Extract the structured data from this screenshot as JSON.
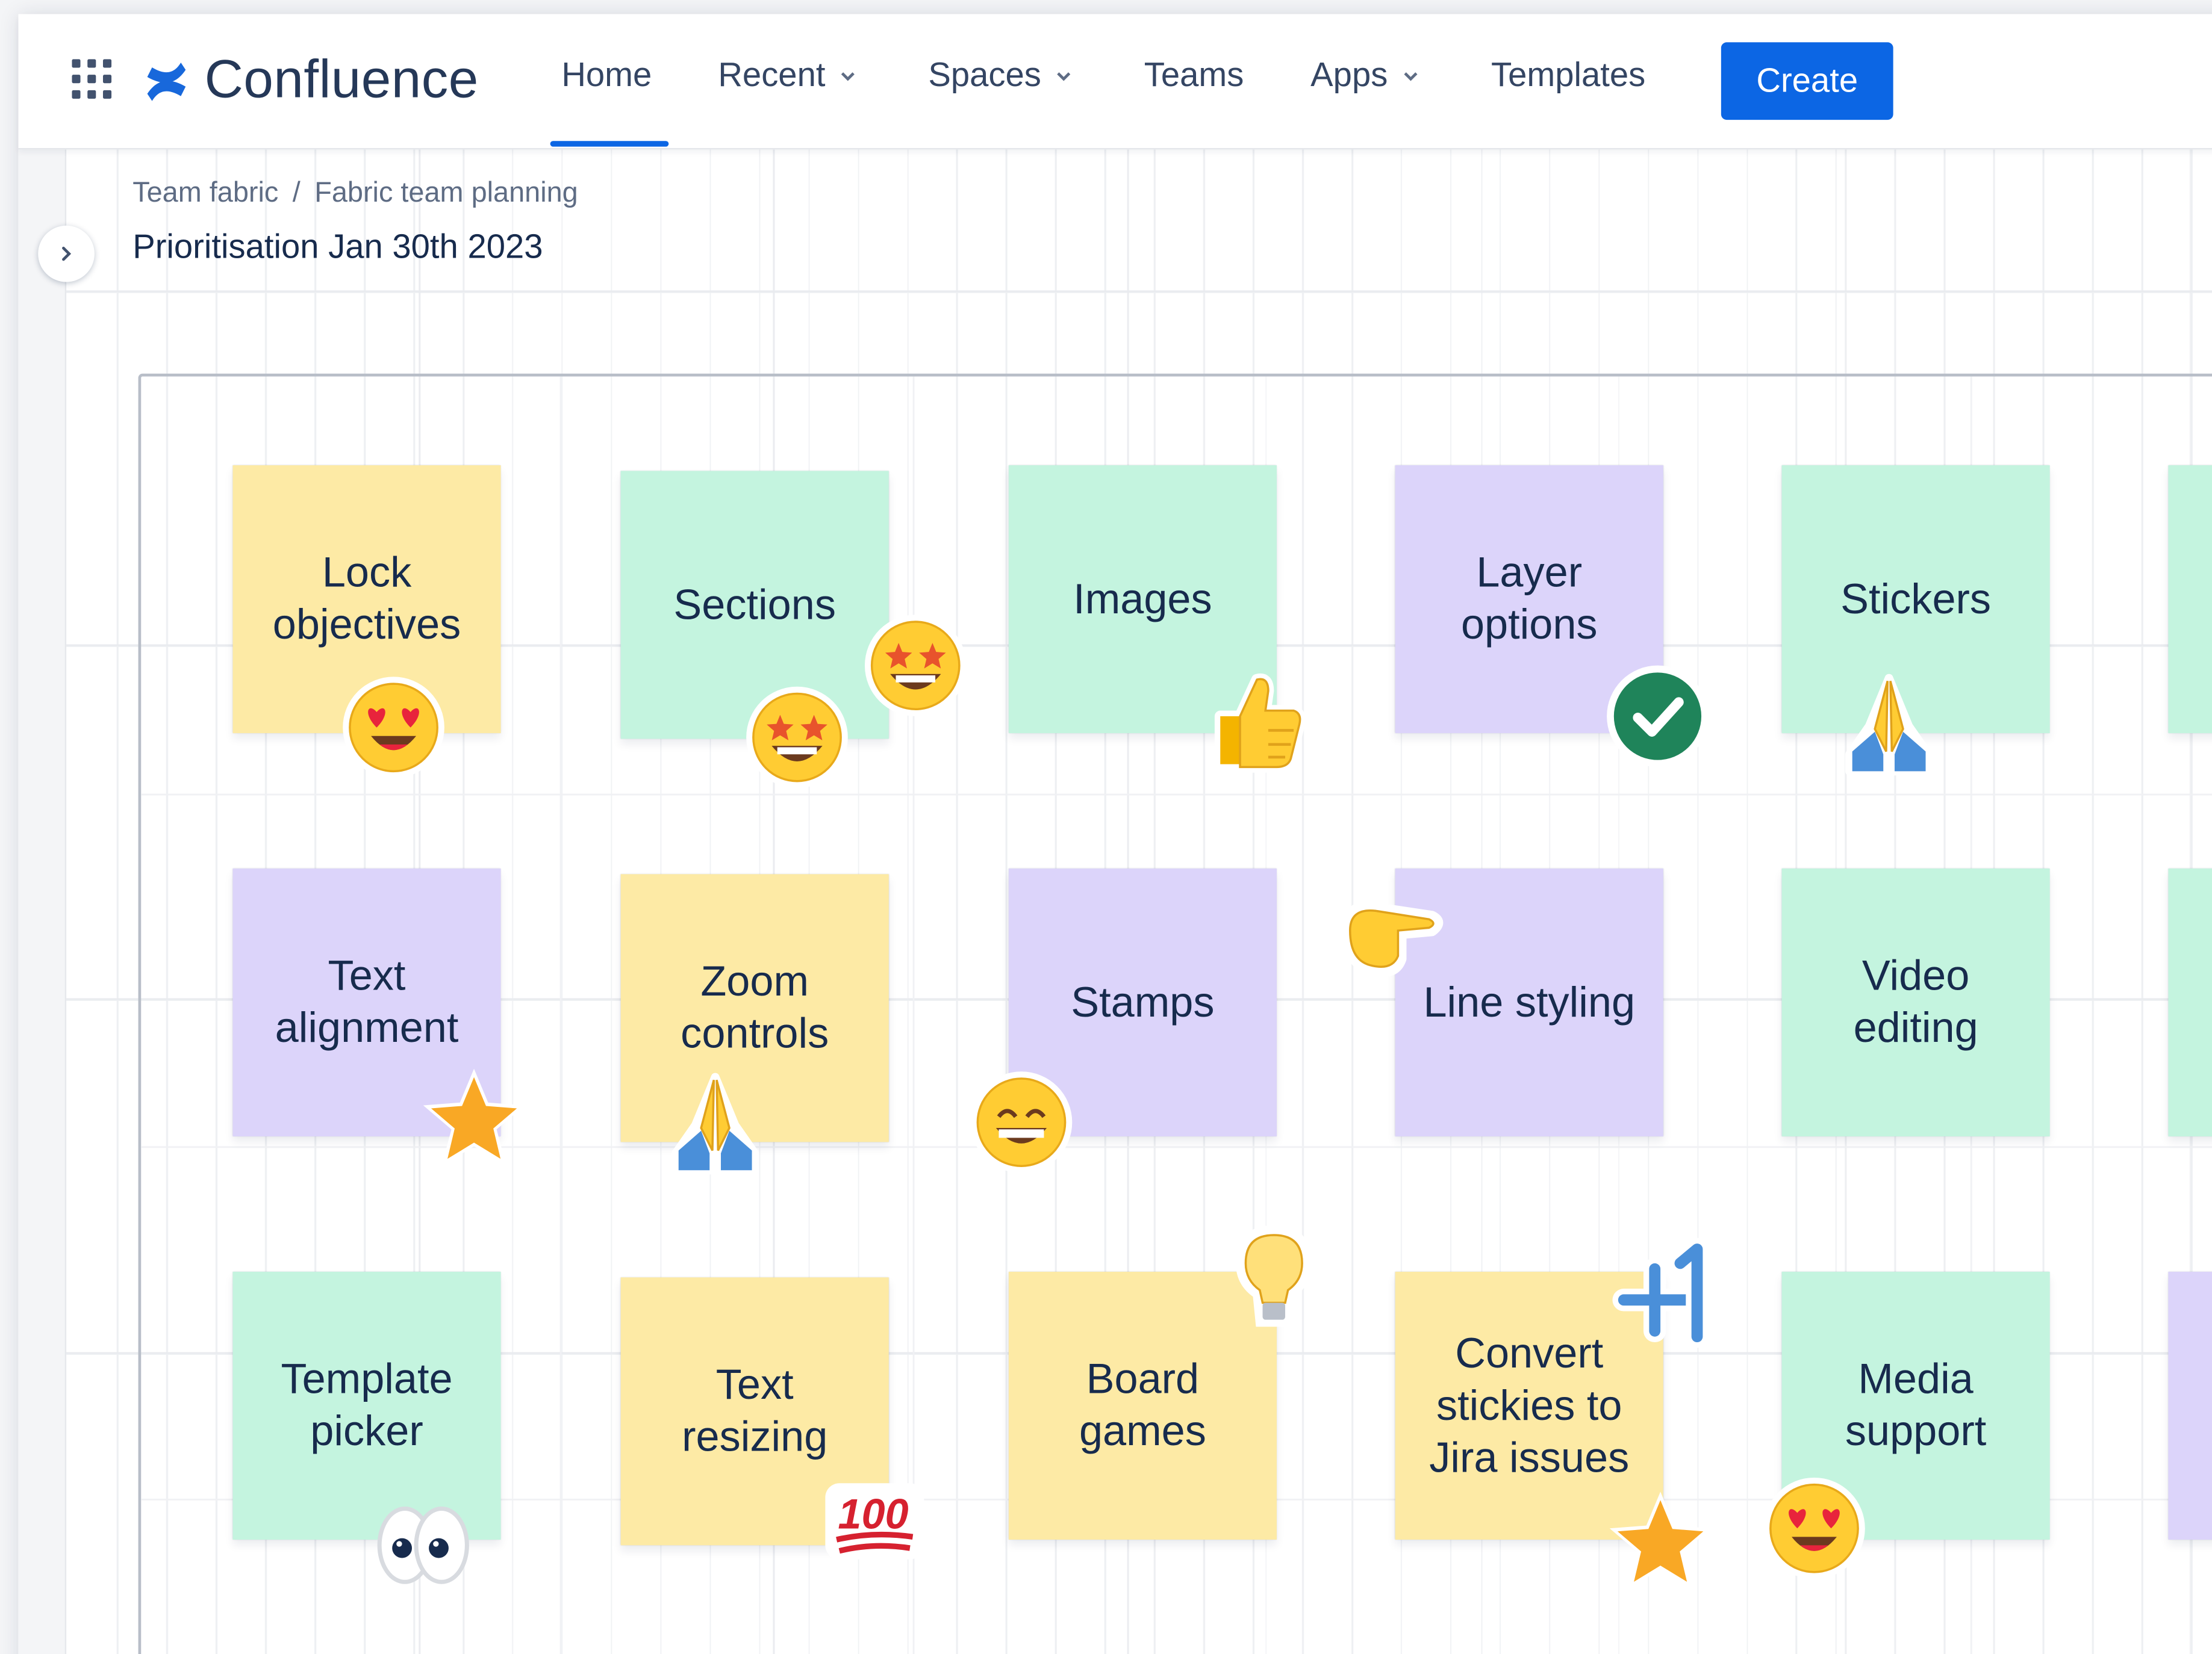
{
  "app": {
    "name": "Confluence",
    "accent": "#0c66e4"
  },
  "nav": {
    "items": [
      {
        "label": "Home",
        "dropdown": false,
        "active": true
      },
      {
        "label": "Recent",
        "dropdown": true
      },
      {
        "label": "Spaces",
        "dropdown": true
      },
      {
        "label": "Teams",
        "dropdown": false
      },
      {
        "label": "Apps",
        "dropdown": true
      },
      {
        "label": "Templates",
        "dropdown": false
      }
    ],
    "create_label": "Create"
  },
  "breadcrumb": {
    "items": [
      "Team fabric",
      "Fabric team planning"
    ],
    "separator": "/"
  },
  "page": {
    "title": "Prioritisation Jan 30th 2023"
  },
  "colors": {
    "yellow": "#fdeaa5",
    "green": "#c4f4df",
    "purple": "#dcd4fa"
  },
  "stickies": [
    {
      "label": "Lock\nobjectives",
      "color": "yellow",
      "sticker": "heart-eyes-icon"
    },
    {
      "label": "Sections",
      "color": "green",
      "sticker": "star-struck-icon"
    },
    {
      "label": "Images",
      "color": "green",
      "sticker": "thumbs-up-icon"
    },
    {
      "label": "Layer\noptions",
      "color": "purple",
      "sticker": "check-mark-icon"
    },
    {
      "label": "Stickers",
      "color": "green",
      "sticker": "folded-hands-icon"
    },
    {
      "label": "Text\nalignment",
      "color": "purple",
      "sticker": "star-icon"
    },
    {
      "label": "Zoom\ncontrols",
      "color": "yellow",
      "sticker": "folded-hands-icon"
    },
    {
      "label": "Stamps",
      "color": "purple",
      "sticker": "grinning-face-icon"
    },
    {
      "label": "Line styling",
      "color": "purple",
      "sticker": "pointing-hand-icon"
    },
    {
      "label": "Video\nediting",
      "color": "green",
      "sticker": null
    },
    {
      "label": "Template\npicker",
      "color": "green",
      "sticker": "eyes-icon"
    },
    {
      "label": "Text\nresizing",
      "color": "yellow",
      "sticker": "hundred-points-icon"
    },
    {
      "label": "Board\ngames",
      "color": "yellow",
      "sticker": "light-bulb-icon"
    },
    {
      "label": "Convert\nstickies to\nJira issues",
      "color": "yellow",
      "sticker": "plus-one-icon"
    },
    {
      "label": "Media\nsupport",
      "color": "green",
      "sticker": "heart-eyes-icon"
    }
  ],
  "edge_stickies": [
    {
      "color": "green"
    },
    {
      "color": "green"
    },
    {
      "color": "purple"
    }
  ]
}
